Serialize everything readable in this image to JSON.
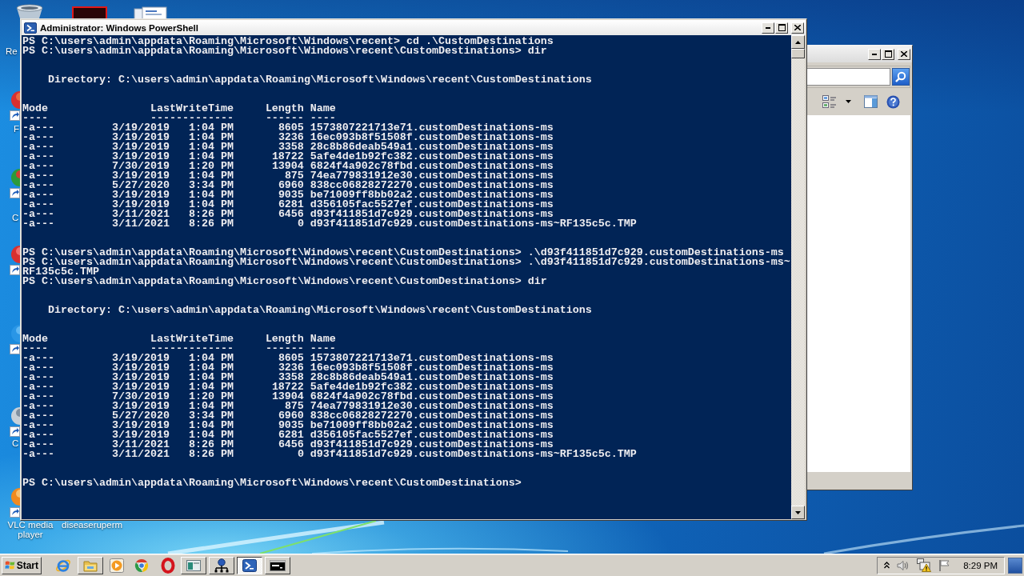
{
  "desktop_icons": [
    {
      "label": "Re"
    },
    {
      "label": "F"
    },
    {
      "label": "C"
    },
    {
      "label": "C"
    },
    {
      "label": "VLC media player"
    },
    {
      "label": "diseaseruperm"
    }
  ],
  "powershell_window": {
    "title": "Administrator: Windows PowerShell",
    "console": {
      "blocks": [
        {
          "kind": "command",
          "text": "PS C:\\users\\admin\\appdata\\Roaming\\Microsoft\\Windows\\recent> cd .\\CustomDestinations"
        },
        {
          "kind": "command",
          "text": "PS C:\\users\\admin\\appdata\\Roaming\\Microsoft\\Windows\\recent\\CustomDestinations> dir"
        },
        {
          "kind": "listing",
          "directory": "Directory: C:\\users\\admin\\appdata\\Roaming\\Microsoft\\Windows\\recent\\CustomDestinations",
          "columns": [
            "Mode",
            "LastWriteTime",
            "Length",
            "Name"
          ],
          "underlines": [
            "----",
            "-------------",
            "------",
            "----"
          ],
          "rows": [
            {
              "mode": "-a---",
              "date": "3/19/2019",
              "time": "1:04 PM",
              "length": "8605",
              "name": "1573807221713e71.customDestinations-ms"
            },
            {
              "mode": "-a---",
              "date": "3/19/2019",
              "time": "1:04 PM",
              "length": "3236",
              "name": "16ec093b8f51508f.customDestinations-ms"
            },
            {
              "mode": "-a---",
              "date": "3/19/2019",
              "time": "1:04 PM",
              "length": "3358",
              "name": "28c8b86deab549a1.customDestinations-ms"
            },
            {
              "mode": "-a---",
              "date": "3/19/2019",
              "time": "1:04 PM",
              "length": "18722",
              "name": "5afe4de1b92fc382.customDestinations-ms"
            },
            {
              "mode": "-a---",
              "date": "7/30/2019",
              "time": "1:20 PM",
              "length": "13904",
              "name": "6824f4a902c78fbd.customDestinations-ms"
            },
            {
              "mode": "-a---",
              "date": "3/19/2019",
              "time": "1:04 PM",
              "length": "875",
              "name": "74ea779831912e30.customDestinations-ms"
            },
            {
              "mode": "-a---",
              "date": "5/27/2020",
              "time": "3:34 PM",
              "length": "6960",
              "name": "838cc06828272270.customDestinations-ms"
            },
            {
              "mode": "-a---",
              "date": "3/19/2019",
              "time": "1:04 PM",
              "length": "9035",
              "name": "be71009ff8bb02a2.customDestinations-ms"
            },
            {
              "mode": "-a---",
              "date": "3/19/2019",
              "time": "1:04 PM",
              "length": "6281",
              "name": "d356105fac5527ef.customDestinations-ms"
            },
            {
              "mode": "-a---",
              "date": "3/11/2021",
              "time": "8:26 PM",
              "length": "6456",
              "name": "d93f411851d7c929.customDestinations-ms"
            },
            {
              "mode": "-a---",
              "date": "3/11/2021",
              "time": "8:26 PM",
              "length": "0",
              "name": "d93f411851d7c929.customDestinations-ms~RF135c5c.TMP"
            }
          ]
        },
        {
          "kind": "command",
          "text": "PS C:\\users\\admin\\appdata\\Roaming\\Microsoft\\Windows\\recent\\CustomDestinations> .\\d93f411851d7c929.customDestinations-ms"
        },
        {
          "kind": "command",
          "text": "PS C:\\users\\admin\\appdata\\Roaming\\Microsoft\\Windows\\recent\\CustomDestinations> .\\d93f411851d7c929.customDestinations-ms~RF135c5c.TMP"
        },
        {
          "kind": "command",
          "text": "PS C:\\users\\admin\\appdata\\Roaming\\Microsoft\\Windows\\recent\\CustomDestinations> dir"
        },
        {
          "kind": "listing",
          "directory": "Directory: C:\\users\\admin\\appdata\\Roaming\\Microsoft\\Windows\\recent\\CustomDestinations",
          "columns": [
            "Mode",
            "LastWriteTime",
            "Length",
            "Name"
          ],
          "underlines": [
            "----",
            "-------------",
            "------",
            "----"
          ],
          "rows": [
            {
              "mode": "-a---",
              "date": "3/19/2019",
              "time": "1:04 PM",
              "length": "8605",
              "name": "1573807221713e71.customDestinations-ms"
            },
            {
              "mode": "-a---",
              "date": "3/19/2019",
              "time": "1:04 PM",
              "length": "3236",
              "name": "16ec093b8f51508f.customDestinations-ms"
            },
            {
              "mode": "-a---",
              "date": "3/19/2019",
              "time": "1:04 PM",
              "length": "3358",
              "name": "28c8b86deab549a1.customDestinations-ms"
            },
            {
              "mode": "-a---",
              "date": "3/19/2019",
              "time": "1:04 PM",
              "length": "18722",
              "name": "5afe4de1b92fc382.customDestinations-ms"
            },
            {
              "mode": "-a---",
              "date": "7/30/2019",
              "time": "1:20 PM",
              "length": "13904",
              "name": "6824f4a902c78fbd.customDestinations-ms"
            },
            {
              "mode": "-a---",
              "date": "3/19/2019",
              "time": "1:04 PM",
              "length": "875",
              "name": "74ea779831912e30.customDestinations-ms"
            },
            {
              "mode": "-a---",
              "date": "5/27/2020",
              "time": "3:34 PM",
              "length": "6960",
              "name": "838cc06828272270.customDestinations-ms"
            },
            {
              "mode": "-a---",
              "date": "3/19/2019",
              "time": "1:04 PM",
              "length": "9035",
              "name": "be71009ff8bb02a2.customDestinations-ms"
            },
            {
              "mode": "-a---",
              "date": "3/19/2019",
              "time": "1:04 PM",
              "length": "6281",
              "name": "d356105fac5527ef.customDestinations-ms"
            },
            {
              "mode": "-a---",
              "date": "3/11/2021",
              "time": "8:26 PM",
              "length": "6456",
              "name": "d93f411851d7c929.customDestinations-ms"
            },
            {
              "mode": "-a---",
              "date": "3/11/2021",
              "time": "8:26 PM",
              "length": "0",
              "name": "d93f411851d7c929.customDestinations-ms~RF135c5c.TMP"
            }
          ]
        },
        {
          "kind": "command",
          "text": "PS C:\\users\\admin\\appdata\\Roaming\\Microsoft\\Windows\\recent\\CustomDestinations>"
        }
      ]
    }
  },
  "taskbar": {
    "start_label": "Start",
    "buttons": [
      {
        "selected": false
      },
      {
        "selected": false
      },
      {
        "selected": false
      },
      {
        "selected": true
      },
      {
        "selected": false
      }
    ],
    "clock": "8:29 PM"
  }
}
